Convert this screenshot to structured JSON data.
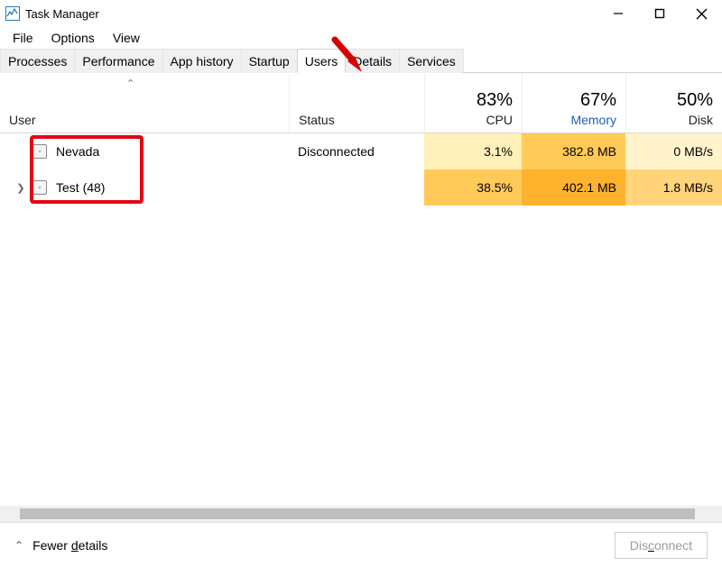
{
  "window": {
    "title": "Task Manager"
  },
  "menu": {
    "file": "File",
    "options": "Options",
    "view": "View"
  },
  "tabs": {
    "processes": "Processes",
    "performance": "Performance",
    "app_history": "App history",
    "startup": "Startup",
    "users": "Users",
    "details": "Details",
    "services": "Services",
    "active": "users"
  },
  "columns": {
    "user": "User",
    "status": "Status",
    "cpu": {
      "pct": "83%",
      "label": "CPU"
    },
    "memory": {
      "pct": "67%",
      "label": "Memory"
    },
    "disk": {
      "pct": "50%",
      "label": "Disk"
    }
  },
  "rows": [
    {
      "name": "Nevada",
      "status": "Disconnected",
      "cpu": "3.1%",
      "memory": "382.8 MB",
      "disk": "0 MB/s",
      "expandable": false
    },
    {
      "name": "Test (48)",
      "status": "",
      "cpu": "38.5%",
      "memory": "402.1 MB",
      "disk": "1.8 MB/s",
      "expandable": true
    }
  ],
  "footer": {
    "fewer_details": "Fewer details",
    "disconnect": "Disconnect"
  }
}
